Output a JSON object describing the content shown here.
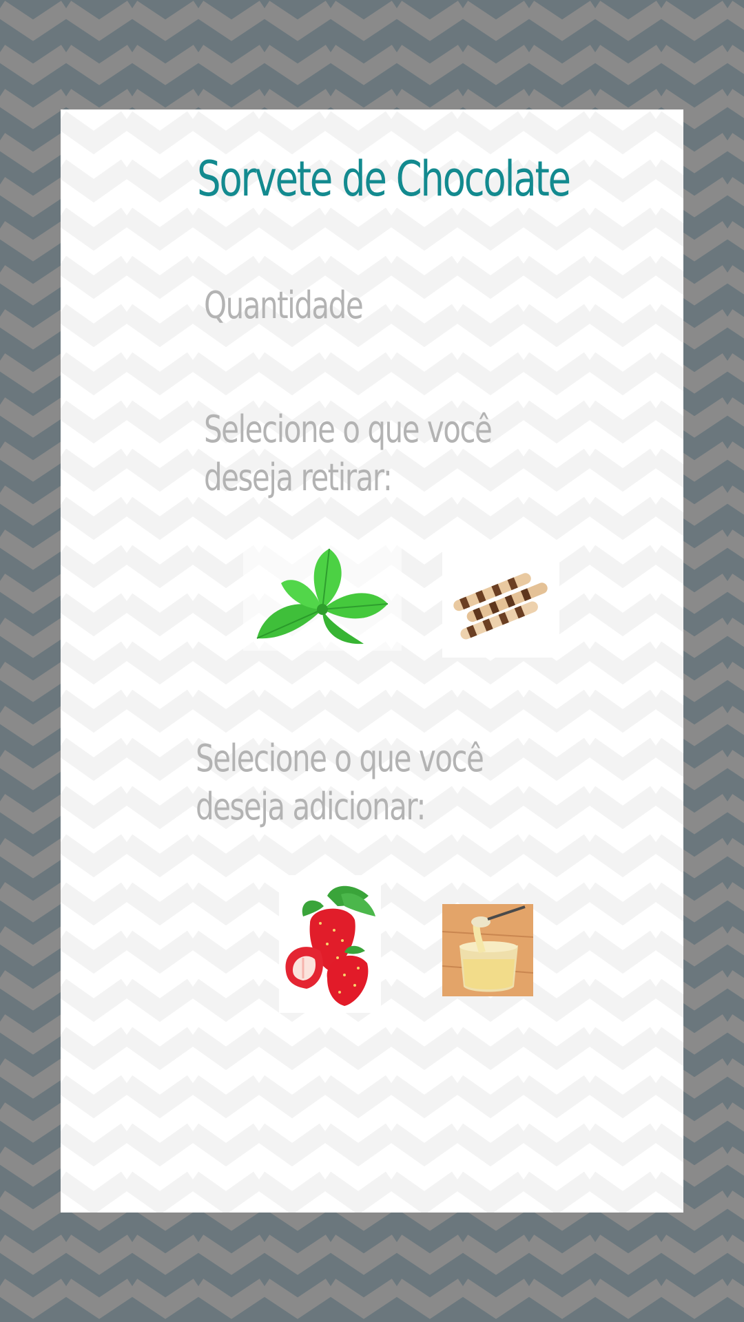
{
  "page": {
    "title": "Sorvete de Chocolate",
    "quantity_label": "Quantidade",
    "remove_label": "Selecione o que você deseja retirar:",
    "add_label": "Selecione o que você deseja adicionar:"
  },
  "remove_options": [
    {
      "name": "mint-leaves",
      "icon": "mint-leaves-image"
    },
    {
      "name": "wafer-rolls",
      "icon": "wafer-rolls-image"
    }
  ],
  "add_options": [
    {
      "name": "strawberries",
      "icon": "strawberries-image"
    },
    {
      "name": "condensed-milk",
      "icon": "condensed-milk-image"
    }
  ],
  "colors": {
    "background": "#6b777d",
    "background_chevron": "#8a8a8a",
    "card": "#ffffff",
    "card_chevron": "#f3f3f3",
    "title": "#138a8f",
    "label": "#b3b3b3"
  }
}
